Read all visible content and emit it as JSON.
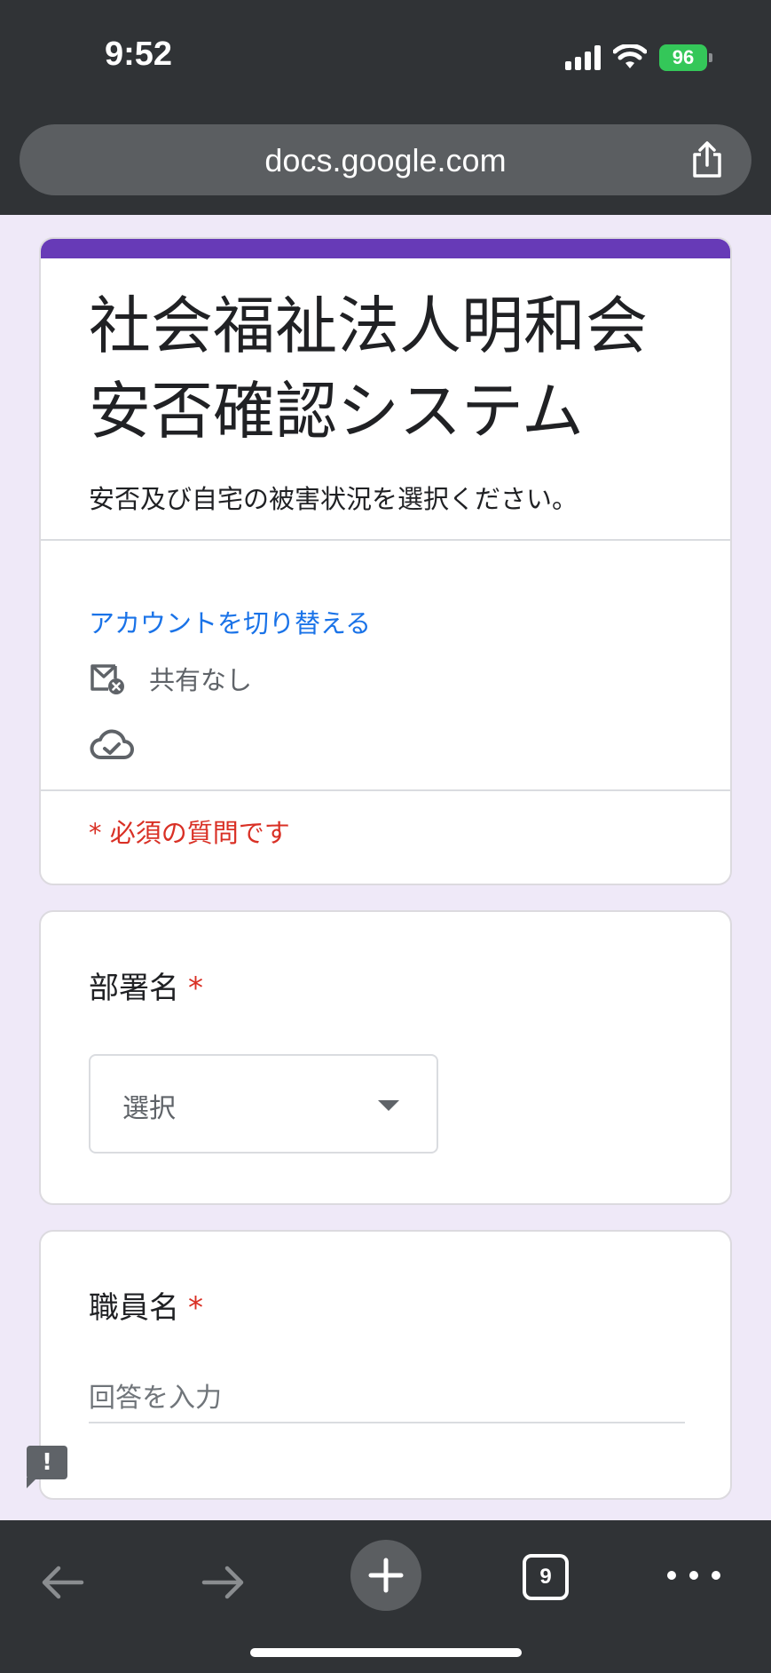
{
  "status_bar": {
    "time": "9:52",
    "battery": "96",
    "icons": [
      "signal-icon",
      "wifi-icon",
      "battery-icon"
    ]
  },
  "browser": {
    "url": "docs.google.com",
    "tab_count": "9",
    "icons": [
      "share-icon",
      "back-arrow-icon",
      "forward-arrow-icon",
      "plus-icon",
      "tabs-icon",
      "more-icon"
    ]
  },
  "form": {
    "accent_color": "#673ab7",
    "title": "社会福祉法人明和会安否確認システム",
    "description": "安否及び自宅の被害状況を選択ください。",
    "switch_account": "アカウントを切り替える",
    "share_status": "共有なし",
    "required_note": "* 必須の質問です"
  },
  "questions": [
    {
      "label": "部署名",
      "required_mark": "*",
      "type": "dropdown",
      "selected": "選択"
    },
    {
      "label": "職員名",
      "required_mark": "*",
      "type": "text",
      "placeholder": "回答を入力"
    }
  ],
  "feedback": {
    "label": "!"
  }
}
